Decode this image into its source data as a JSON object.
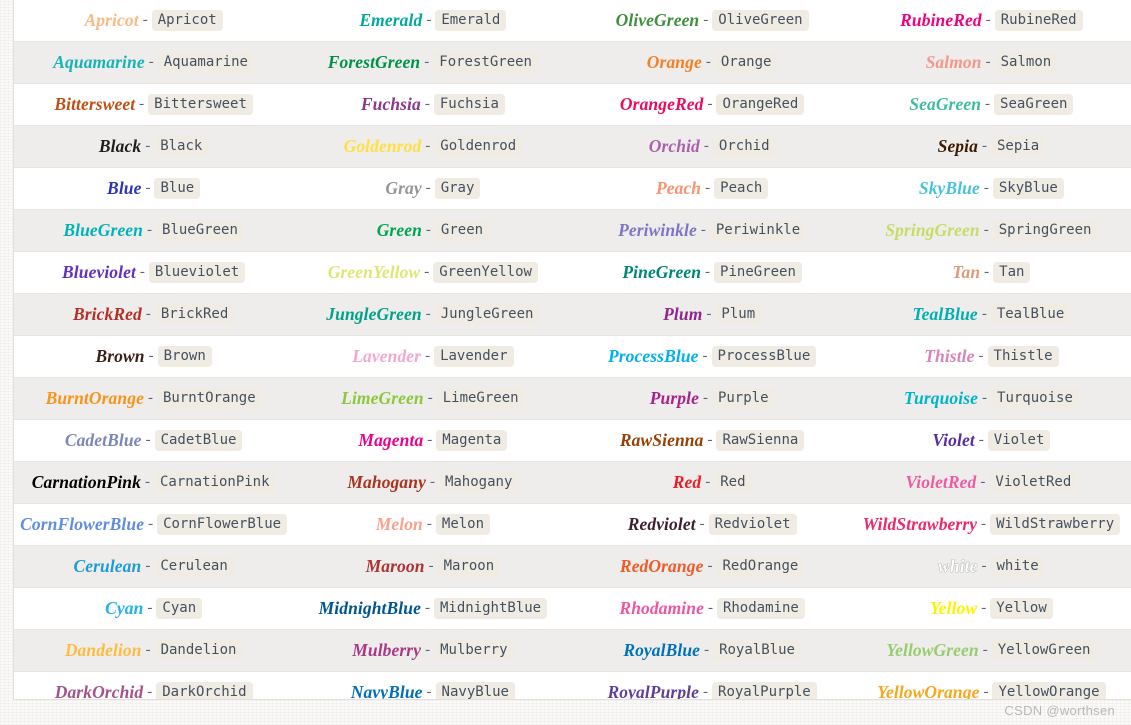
{
  "watermark": "CSDN @worthsen",
  "separator": "-",
  "table": {
    "columns": 4,
    "rows": [
      [
        {
          "name": "Apricot",
          "code": "Apricot",
          "color": "#fbb982"
        },
        {
          "name": "Emerald",
          "code": "Emerald",
          "color": "#00a99d"
        },
        {
          "name": "OliveGreen",
          "code": "OliveGreen",
          "color": "#3f8f3f"
        },
        {
          "name": "RubineRed",
          "code": "RubineRed",
          "color": "#ed017f"
        }
      ],
      [
        {
          "name": "Aquamarine",
          "code": "Aquamarine",
          "color": "#18b3b7"
        },
        {
          "name": "ForestGreen",
          "code": "ForestGreen",
          "color": "#009247"
        },
        {
          "name": "Orange",
          "code": "Orange",
          "color": "#f58025"
        },
        {
          "name": "Salmon",
          "code": "Salmon",
          "color": "#f7968b"
        }
      ],
      [
        {
          "name": "Bittersweet",
          "code": "Bittersweet",
          "color": "#c04f17"
        },
        {
          "name": "Fuchsia",
          "code": "Fuchsia",
          "color": "#8c368c"
        },
        {
          "name": "OrangeRed",
          "code": "OrangeRed",
          "color": "#ed0b5b"
        },
        {
          "name": "SeaGreen",
          "code": "SeaGreen",
          "color": "#3fbc9d"
        }
      ],
      [
        {
          "name": "Black",
          "code": "Black",
          "color": "#221e1f"
        },
        {
          "name": "Goldenrod",
          "code": "Goldenrod",
          "color": "#ffdf42"
        },
        {
          "name": "Orchid",
          "code": "Orchid",
          "color": "#ad5fb0"
        },
        {
          "name": "Sepia",
          "code": "Sepia",
          "color": "#3d1c00"
        }
      ],
      [
        {
          "name": "Blue",
          "code": "Blue",
          "color": "#2b35b8"
        },
        {
          "name": "Gray",
          "code": "Gray",
          "color": "#949599"
        },
        {
          "name": "Peach",
          "code": "Peach",
          "color": "#f8926f"
        },
        {
          "name": "SkyBlue",
          "code": "SkyBlue",
          "color": "#46c3d8"
        }
      ],
      [
        {
          "name": "BlueGreen",
          "code": "BlueGreen",
          "color": "#00b3b8"
        },
        {
          "name": "Green",
          "code": "Green",
          "color": "#00a551"
        },
        {
          "name": "Periwinkle",
          "code": "Periwinkle",
          "color": "#7e76c5"
        },
        {
          "name": "SpringGreen",
          "code": "SpringGreen",
          "color": "#c6dc67"
        }
      ],
      [
        {
          "name": "Blueviolet",
          "code": "Blueviolet",
          "color": "#6130c4"
        },
        {
          "name": "GreenYellow",
          "code": "GreenYellow",
          "color": "#dfe674"
        },
        {
          "name": "PineGreen",
          "code": "PineGreen",
          "color": "#008576"
        },
        {
          "name": "Tan",
          "code": "Tan",
          "color": "#db9d7a"
        }
      ],
      [
        {
          "name": "BrickRed",
          "code": "BrickRed",
          "color": "#b42f28"
        },
        {
          "name": "JungleGreen",
          "code": "JungleGreen",
          "color": "#00a28a"
        },
        {
          "name": "Plum",
          "code": "Plum",
          "color": "#92268f"
        },
        {
          "name": "TealBlue",
          "code": "TealBlue",
          "color": "#00aeb3"
        }
      ],
      [
        {
          "name": "Brown",
          "code": "Brown",
          "color": "#3b1f14"
        },
        {
          "name": "Lavender",
          "code": "Lavender",
          "color": "#f4a8d0"
        },
        {
          "name": "ProcessBlue",
          "code": "ProcessBlue",
          "color": "#00b0f0"
        },
        {
          "name": "Thistle",
          "code": "Thistle",
          "color": "#d884b7"
        }
      ],
      [
        {
          "name": "BurntOrange",
          "code": "BurntOrange",
          "color": "#f7941d"
        },
        {
          "name": "LimeGreen",
          "code": "LimeGreen",
          "color": "#8dc63f"
        },
        {
          "name": "Purple",
          "code": "Purple",
          "color": "#a9218e"
        },
        {
          "name": "Turquoise",
          "code": "Turquoise",
          "color": "#00b4ce"
        }
      ],
      [
        {
          "name": "CadetBlue",
          "code": "CadetBlue",
          "color": "#7a87b8"
        },
        {
          "name": "Magenta",
          "code": "Magenta",
          "color": "#ec008c"
        },
        {
          "name": "RawSienna",
          "code": "RawSienna",
          "color": "#974006"
        },
        {
          "name": "Violet",
          "code": "Violet",
          "color": "#5a2d9e"
        }
      ],
      [
        {
          "name": "CarnationPink",
          "code": "CarnationPink",
          "color": "#f printed"
        },
        {
          "name": "Mahogany",
          "code": "Mahogany",
          "color": "#a9341f"
        },
        {
          "name": "Red",
          "code": "Red",
          "color": "#ed1c24"
        },
        {
          "name": "VioletRed",
          "code": "VioletRed",
          "color": "#ef5ba1"
        }
      ],
      [
        {
          "name": "CornFlowerBlue",
          "code": "CornFlowerBlue",
          "color": "#5f8ddf"
        },
        {
          "name": "Melon",
          "code": "Melon",
          "color": "#f8a28e"
        },
        {
          "name": "Redviolet",
          "code": "Redviolet",
          "color": "#3f1f2f"
        },
        {
          "name": "WildStrawberry",
          "code": "WildStrawberry",
          "color": "#ee2967"
        }
      ],
      [
        {
          "name": "Cerulean",
          "code": "Cerulean",
          "color": "#1e9bd7"
        },
        {
          "name": "Maroon",
          "code": "Maroon",
          "color": "#af3235"
        },
        {
          "name": "RedOrange",
          "code": "RedOrange",
          "color": "#f15a29"
        },
        {
          "name": "white",
          "code": "white",
          "color": "#ffffff"
        }
      ],
      [
        {
          "name": "Cyan",
          "code": "Cyan",
          "color": "#22b2ea"
        },
        {
          "name": "MidnightBlue",
          "code": "MidnightBlue",
          "color": "#00548f"
        },
        {
          "name": "Rhodamine",
          "code": "Rhodamine",
          "color": "#ef559f"
        },
        {
          "name": "Yellow",
          "code": "Yellow",
          "color": "#fff200"
        }
      ],
      [
        {
          "name": "Dandelion",
          "code": "Dandelion",
          "color": "#fdbc42"
        },
        {
          "name": "Mulberry",
          "code": "Mulberry",
          "color": "#a93984"
        },
        {
          "name": "RoyalBlue",
          "code": "RoyalBlue",
          "color": "#0071bc"
        },
        {
          "name": "YellowGreen",
          "code": "YellowGreen",
          "color": "#98cc70"
        }
      ],
      [
        {
          "name": "DarkOrchid",
          "code": "DarkOrchid",
          "color": "#a4538a"
        },
        {
          "name": "NavyBlue",
          "code": "NavyBlue",
          "color": "#006eb8"
        },
        {
          "name": "RoyalPurple",
          "code": "RoyalPurple",
          "color": "#613f99"
        },
        {
          "name": "YellowOrange",
          "code": "YellowOrange",
          "color": "#faa61a"
        }
      ]
    ]
  }
}
